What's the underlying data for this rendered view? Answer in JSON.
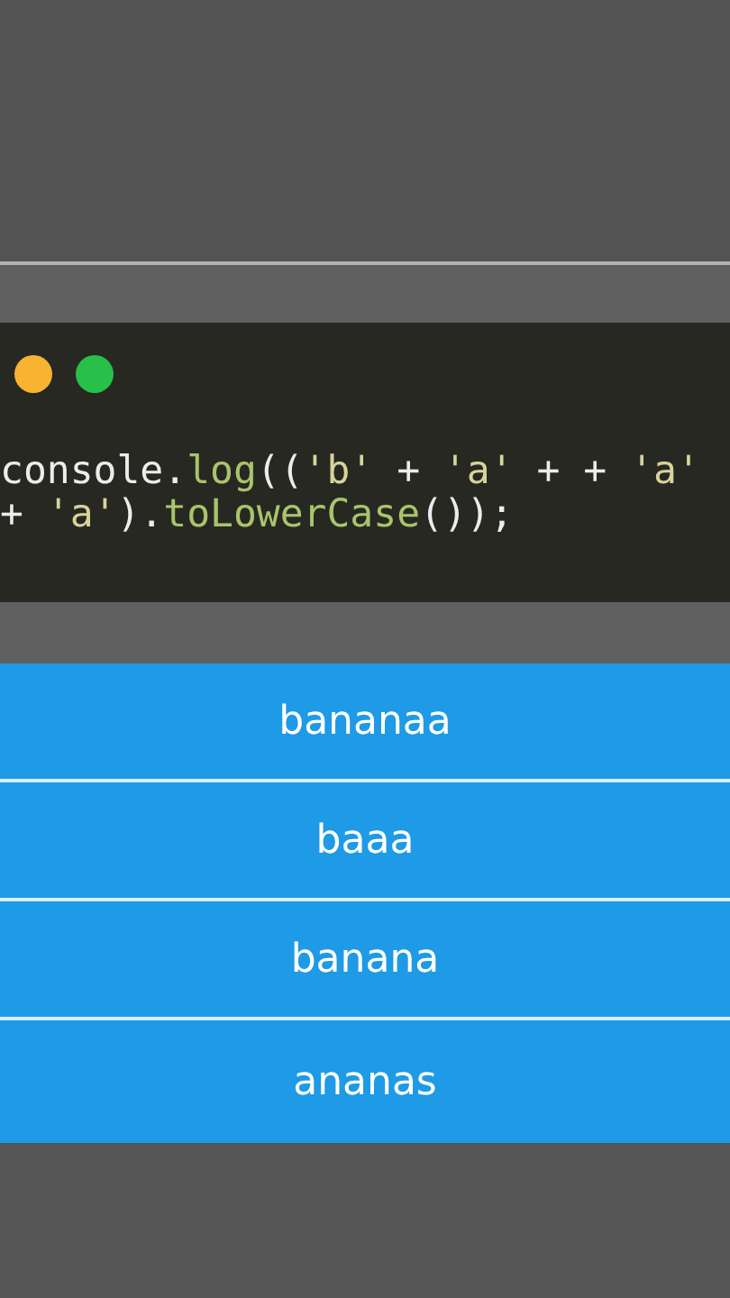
{
  "code_window": {
    "dots": [
      {
        "color": "#f8b330"
      },
      {
        "color": "#27c14a"
      }
    ],
    "lines": [
      [
        {
          "kind": "plain",
          "text": "console."
        },
        {
          "kind": "fn",
          "text": "log"
        },
        {
          "kind": "plain",
          "text": "(("
        },
        {
          "kind": "str",
          "text": "'b'"
        },
        {
          "kind": "plain",
          "text": " + "
        },
        {
          "kind": "str",
          "text": "'a'"
        },
        {
          "kind": "plain",
          "text": " + + "
        },
        {
          "kind": "str",
          "text": "'a'"
        }
      ],
      [
        {
          "kind": "plain",
          "text": "+ "
        },
        {
          "kind": "str",
          "text": "'a'"
        },
        {
          "kind": "plain",
          "text": ")."
        },
        {
          "kind": "fn",
          "text": "toLowerCase"
        },
        {
          "kind": "plain",
          "text": "());"
        }
      ]
    ]
  },
  "answers": [
    {
      "label": "bananaa"
    },
    {
      "label": "baaa"
    },
    {
      "label": "banana"
    },
    {
      "label": "ananas"
    }
  ]
}
